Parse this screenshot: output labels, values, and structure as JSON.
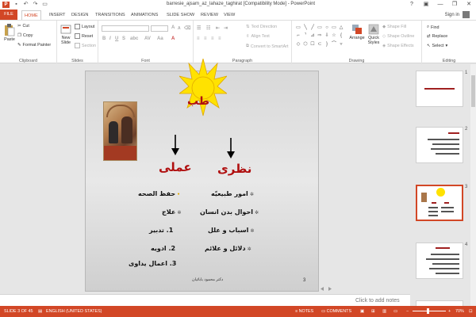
{
  "window": {
    "title": "barresie_ajsam_az_lahaze_taghirat [Compatibility Mode] - PowerPoint",
    "app_badge": "P",
    "minimize": "—",
    "maximize": "❐",
    "close": "✕",
    "help": "?"
  },
  "tabs": [
    "FILE",
    "HOME",
    "INSERT",
    "DESIGN",
    "TRANSITIONS",
    "ANIMATIONS",
    "SLIDE SHOW",
    "REVIEW",
    "VIEW"
  ],
  "signin": "Sign in",
  "ribbon": {
    "clipboard": {
      "label": "Clipboard",
      "paste": "Paste",
      "cut": "Cut",
      "copy": "Copy",
      "format_painter": "Format Painter"
    },
    "slides": {
      "label": "Slides",
      "new_slide": "New",
      "new_slide2": "Slide",
      "layout": "Layout",
      "reset": "Reset",
      "section": "Section"
    },
    "font": {
      "label": "Font"
    },
    "paragraph": {
      "label": "Paragraph",
      "text_direction": "Text Direction",
      "align_text": "Align Text",
      "convert_smartart": "Convert to SmartArt"
    },
    "drawing": {
      "label": "Drawing",
      "arrange": "Arrange",
      "quick_styles": "Quick",
      "quick_styles2": "Styles",
      "shape_fill": "Shape Fill",
      "shape_outline": "Shape Outline",
      "shape_effects": "Shape Effects"
    },
    "editing": {
      "label": "Editing",
      "find": "Find",
      "replace": "Replace",
      "select": "Select"
    }
  },
  "slide": {
    "sun_text": "طب",
    "left_heading": "عملی",
    "right_heading": "نظری",
    "right_items": [
      "امور طبیعیّه",
      "احوال بدن انسان",
      "اسباب و علل",
      "دلائل و علائم"
    ],
    "left_items": [
      "حفظ الصحه",
      "علاج",
      "1. تدبیر",
      "2.  ادویه",
      "3. اعمال یداوی"
    ],
    "footer": "دکتر محمود بابائیان",
    "number": "3"
  },
  "thumbnails": [
    {
      "num": "1",
      "title": "بررسی اجسام از لحاظ تغییرات"
    },
    {
      "num": "2",
      "title": "طبیعیّات"
    },
    {
      "num": "3",
      "title": "طب"
    },
    {
      "num": "4",
      "title": "امور طبیعیّه"
    }
  ],
  "notes_placeholder": "Click to add notes",
  "status": {
    "slide_of": "SLIDE 3 OF 45",
    "language": "ENGLISH (UNITED STATES)",
    "notes": "NOTES",
    "comments": "COMMENTS",
    "zoom": "70%"
  },
  "colors": {
    "accent": "#d24726",
    "heading_red": "#b01010",
    "sun": "#ffe200"
  }
}
